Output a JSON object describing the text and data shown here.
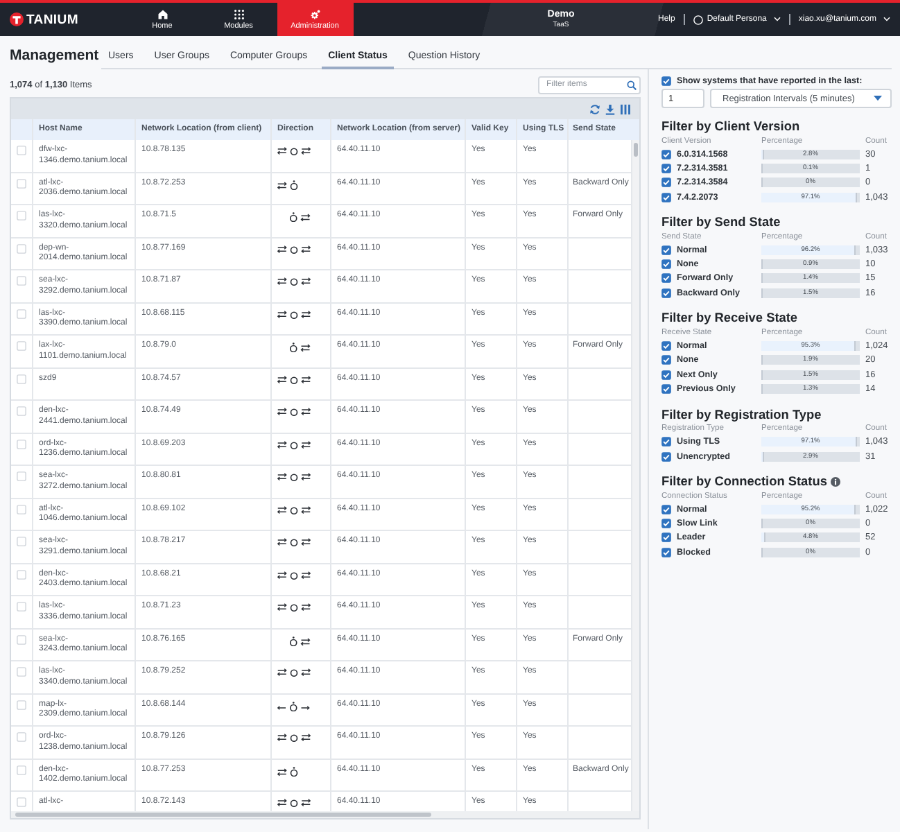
{
  "top_bar": {
    "logo": "TANIUM",
    "nav": [
      {
        "label": "Home",
        "kind": "home",
        "selected": false
      },
      {
        "label": "Modules",
        "kind": "grid",
        "selected": false
      },
      {
        "label": "Administration",
        "kind": "gear",
        "selected": true
      }
    ],
    "environment": {
      "name": "Demo",
      "label": "TaaS"
    },
    "help": "Help",
    "persona": "Default Persona",
    "user": "xiao.xu@tanium.com"
  },
  "header": {
    "title": "Management",
    "tabs": [
      {
        "label": "Users",
        "selected": false
      },
      {
        "label": "User Groups",
        "selected": false
      },
      {
        "label": "Computer Groups",
        "selected": false
      },
      {
        "label": "Client Status",
        "selected": true
      },
      {
        "label": "Question History",
        "selected": false
      }
    ]
  },
  "clients": {
    "summary": "**1,074** of **1,130** Items",
    "filter": {
      "placeholder": "Filter items"
    },
    "table": {
      "columns": [
        "Host Name",
        "Network Location (from client)",
        "Direction",
        "Network Location (from server)",
        "Valid Key",
        "Using TLS",
        "Send State"
      ],
      "rows": [
        {
          "checked": false,
          "host": "dfw-lxc-1346.demo.tanium.local",
          "client_location": "10.8.78.135",
          "direction": {
            "kind": "both"
          },
          "server_location": "64.40.11.10",
          "valid_key": "Yes",
          "using_tls": "Yes"
        },
        {
          "checked": false,
          "host": "atl-lxc-2036.demo.tanium.local",
          "client_location": "10.8.72.253",
          "direction": {
            "kind": "backward"
          },
          "server_location": "64.40.11.10",
          "valid_key": "Yes",
          "using_tls": "Yes",
          "send_state": "Backward Only"
        },
        {
          "checked": false,
          "host": "las-lxc-3320.demo.tanium.local",
          "client_location": "10.8.71.5",
          "direction": {
            "kind": "forward"
          },
          "server_location": "64.40.11.10",
          "valid_key": "Yes",
          "using_tls": "Yes",
          "send_state": "Forward Only"
        },
        {
          "checked": false,
          "host": "dep-wn-2014.demo.tanium.local",
          "client_location": "10.8.77.169",
          "direction": {
            "kind": "both"
          },
          "server_location": "64.40.11.10",
          "valid_key": "Yes",
          "using_tls": "Yes"
        },
        {
          "checked": false,
          "host": "sea-lxc-3292.demo.tanium.local",
          "client_location": "10.8.71.87",
          "direction": {
            "kind": "both"
          },
          "server_location": "64.40.11.10",
          "valid_key": "Yes",
          "using_tls": "Yes"
        },
        {
          "checked": false,
          "host": "las-lxc-3390.demo.tanium.local",
          "client_location": "10.8.68.115",
          "direction": {
            "kind": "both"
          },
          "server_location": "64.40.11.10",
          "valid_key": "Yes",
          "using_tls": "Yes"
        },
        {
          "checked": false,
          "host": "lax-lxc-1101.demo.tanium.local",
          "client_location": "10.8.79.0",
          "direction": {
            "kind": "forward"
          },
          "server_location": "64.40.11.10",
          "valid_key": "Yes",
          "using_tls": "Yes",
          "send_state": "Forward Only"
        },
        {
          "checked": false,
          "host": "szd9",
          "client_location": "10.8.74.57",
          "direction": {
            "kind": "both"
          },
          "server_location": "64.40.11.10",
          "valid_key": "Yes",
          "using_tls": "Yes"
        },
        {
          "checked": false,
          "host": "den-lxc-2441.demo.tanium.local",
          "client_location": "10.8.74.49",
          "direction": {
            "kind": "both"
          },
          "server_location": "64.40.11.10",
          "valid_key": "Yes",
          "using_tls": "Yes"
        },
        {
          "checked": false,
          "host": "ord-lxc-1236.demo.tanium.local",
          "client_location": "10.8.69.203",
          "direction": {
            "kind": "both"
          },
          "server_location": "64.40.11.10",
          "valid_key": "Yes",
          "using_tls": "Yes"
        },
        {
          "checked": false,
          "host": "sea-lxc-3272.demo.tanium.local",
          "client_location": "10.8.80.81",
          "direction": {
            "kind": "both"
          },
          "server_location": "64.40.11.10",
          "valid_key": "Yes",
          "using_tls": "Yes"
        },
        {
          "checked": false,
          "host": "atl-lxc-1046.demo.tanium.local",
          "client_location": "10.8.69.102",
          "direction": {
            "kind": "both"
          },
          "server_location": "64.40.11.10",
          "valid_key": "Yes",
          "using_tls": "Yes"
        },
        {
          "checked": false,
          "host": "sea-lxc-3291.demo.tanium.local",
          "client_location": "10.8.78.217",
          "direction": {
            "kind": "both"
          },
          "server_location": "64.40.11.10",
          "valid_key": "Yes",
          "using_tls": "Yes"
        },
        {
          "checked": false,
          "host": "den-lxc-2403.demo.tanium.local",
          "client_location": "10.8.68.21",
          "direction": {
            "kind": "both"
          },
          "server_location": "64.40.11.10",
          "valid_key": "Yes",
          "using_tls": "Yes"
        },
        {
          "checked": false,
          "host": "las-lxc-3336.demo.tanium.local",
          "client_location": "10.8.71.23",
          "direction": {
            "kind": "both"
          },
          "server_location": "64.40.11.10",
          "valid_key": "Yes",
          "using_tls": "Yes"
        },
        {
          "checked": false,
          "host": "sea-lxc-3243.demo.tanium.local",
          "client_location": "10.8.76.165",
          "direction": {
            "kind": "forward"
          },
          "server_location": "64.40.11.10",
          "valid_key": "Yes",
          "using_tls": "Yes",
          "send_state": "Forward Only"
        },
        {
          "checked": false,
          "host": "las-lxc-3340.demo.tanium.local",
          "client_location": "10.8.79.252",
          "direction": {
            "kind": "both"
          },
          "server_location": "64.40.11.10",
          "valid_key": "Yes",
          "using_tls": "Yes"
        },
        {
          "checked": false,
          "host": "map-lx-2309.demo.tanium.local",
          "client_location": "10.8.68.144",
          "direction": {
            "kind": "outward"
          },
          "server_location": "64.40.11.10",
          "valid_key": "Yes",
          "using_tls": "Yes"
        },
        {
          "checked": false,
          "host": "ord-lxc-1238.demo.tanium.local",
          "client_location": "10.8.79.126",
          "direction": {
            "kind": "both"
          },
          "server_location": "64.40.11.10",
          "valid_key": "Yes",
          "using_tls": "Yes"
        },
        {
          "checked": false,
          "host": "den-lxc-1402.demo.tanium.local",
          "client_location": "10.8.77.253",
          "direction": {
            "kind": "backward"
          },
          "server_location": "64.40.11.10",
          "valid_key": "Yes",
          "using_tls": "Yes",
          "send_state": "Backward Only"
        },
        {
          "checked": false,
          "host": "atl-lxc-",
          "client_location": "10.8.72.143",
          "direction": {
            "kind": "both"
          },
          "server_location": "64.40.11.10",
          "valid_key": "Yes",
          "using_tls": "Yes"
        }
      ]
    }
  },
  "panel": {
    "recent": {
      "checked": true,
      "label": "Show systems that have reported in the last:",
      "value": "1",
      "interval": "Registration Intervals (5 minutes)"
    },
    "filters": [
      {
        "title": "Filter by Client Version",
        "columns": [
          "Client Version",
          "Percentage",
          "Count"
        ],
        "items": [
          {
            "label": "6.0.314.1568",
            "checked": true,
            "level": 0.028,
            "percentage": "2.8%",
            "count": "30"
          },
          {
            "label": "7.2.314.3581",
            "checked": true,
            "level": 0.001,
            "percentage": "0.1%",
            "count": "1"
          },
          {
            "label": "7.2.314.3584",
            "checked": true,
            "level": 0,
            "percentage": "0%",
            "count": "0"
          },
          {
            "label": "7.4.2.2073",
            "checked": true,
            "level": 0.971,
            "percentage": "97.1%",
            "count": "1,043"
          }
        ]
      },
      {
        "title": "Filter by Send State",
        "columns": [
          "Send State",
          "Percentage",
          "Count"
        ],
        "items": [
          {
            "label": "Normal",
            "checked": true,
            "level": 0.962,
            "percentage": "96.2%",
            "count": "1,033"
          },
          {
            "label": "None",
            "checked": true,
            "level": 0.009,
            "percentage": "0.9%",
            "count": "10"
          },
          {
            "label": "Forward Only",
            "checked": true,
            "level": 0.014,
            "percentage": "1.4%",
            "count": "15"
          },
          {
            "label": "Backward Only",
            "checked": true,
            "level": 0.015,
            "percentage": "1.5%",
            "count": "16"
          }
        ]
      },
      {
        "title": "Filter by Receive State",
        "columns": [
          "Receive State",
          "Percentage",
          "Count"
        ],
        "items": [
          {
            "label": "Normal",
            "checked": true,
            "level": 0.953,
            "percentage": "95.3%",
            "count": "1,024"
          },
          {
            "label": "None",
            "checked": true,
            "level": 0.019,
            "percentage": "1.9%",
            "count": "20"
          },
          {
            "label": "Next Only",
            "checked": true,
            "level": 0.015,
            "percentage": "1.5%",
            "count": "16"
          },
          {
            "label": "Previous Only",
            "checked": true,
            "level": 0.013,
            "percentage": "1.3%",
            "count": "14"
          }
        ]
      },
      {
        "title": "Filter by Registration Type",
        "columns": [
          "Registration Type",
          "Percentage",
          "Count"
        ],
        "items": [
          {
            "label": "Using TLS",
            "checked": true,
            "level": 0.971,
            "percentage": "97.1%",
            "count": "1,043"
          },
          {
            "label": "Unencrypted",
            "checked": true,
            "level": 0.029,
            "percentage": "2.9%",
            "count": "31"
          }
        ]
      },
      {
        "title": "Filter by Connection Status",
        "info": true,
        "columns": [
          "Connection Status",
          "Percentage",
          "Count"
        ],
        "items": [
          {
            "label": "Normal",
            "checked": true,
            "level": 0.952,
            "percentage": "95.2%",
            "count": "1,022"
          },
          {
            "label": "Slow Link",
            "checked": true,
            "level": 0,
            "percentage": "0%",
            "count": "0"
          },
          {
            "label": "Leader",
            "checked": true,
            "level": 0.048,
            "percentage": "4.8%",
            "count": "52"
          },
          {
            "label": "Blocked",
            "checked": true,
            "level": 0,
            "percentage": "0%",
            "count": "0"
          }
        ]
      }
    ]
  }
}
